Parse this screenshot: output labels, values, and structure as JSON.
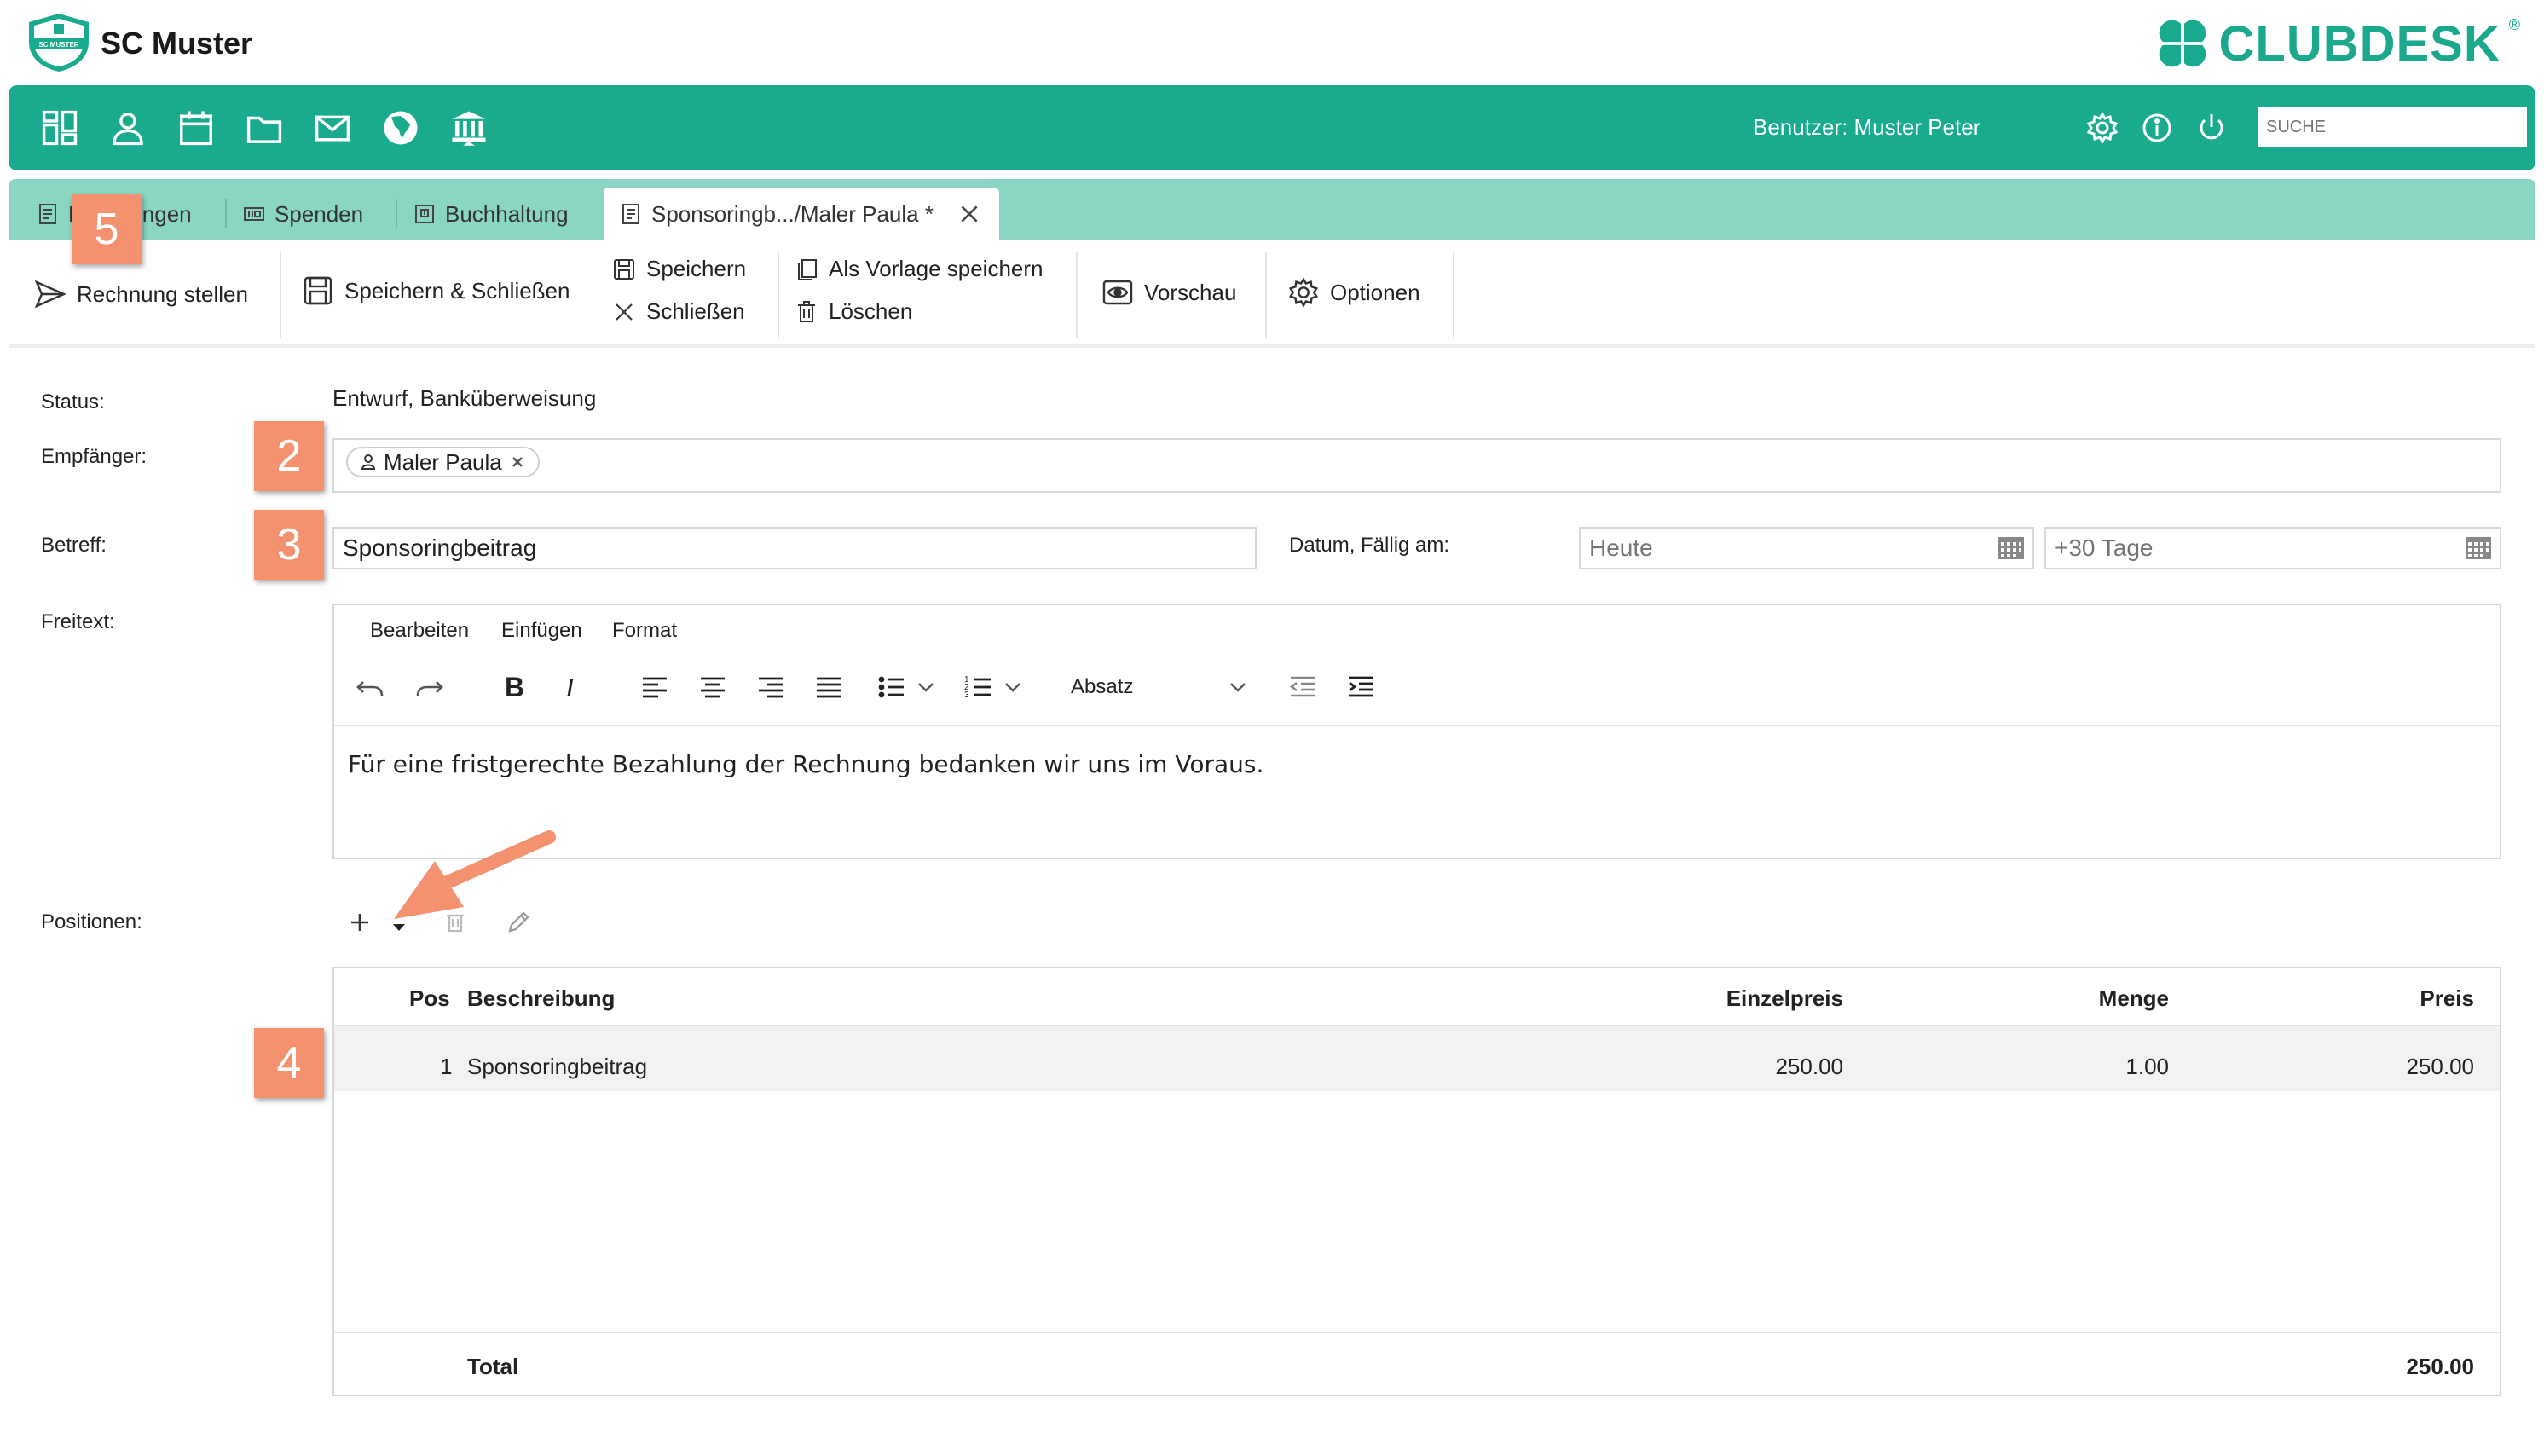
{
  "brand": {
    "club_name": "SC Muster",
    "club_badge_text": "SC MUSTER",
    "product_name": "CLUBDESK",
    "registered_mark": "®",
    "accent_color": "#1aab8e"
  },
  "nav": {
    "icons": [
      "dashboard-icon",
      "person-icon",
      "calendar-icon",
      "folder-icon",
      "mail-icon",
      "globe-icon",
      "bank-icon"
    ],
    "user_label": "Benutzer: Muster Peter",
    "search_placeholder": "SUCHE"
  },
  "tabs": [
    {
      "label": "Rechnungen",
      "visible_label_left": "R",
      "visible_label_right": "ngen",
      "icon": "invoice-icon"
    },
    {
      "label": "Spenden",
      "icon": "donation-icon"
    },
    {
      "label": "Buchhaltung",
      "icon": "ledger-icon"
    },
    {
      "label": "Sponsoringb.../Maler Paula *",
      "icon": "invoice-icon",
      "active": true
    }
  ],
  "toolbar": {
    "send_invoice": "Rechnung stellen",
    "save_close": "Speichern & Schließen",
    "save": "Speichern",
    "close": "Schließen",
    "save_template": "Als Vorlage speichern",
    "delete": "Löschen",
    "preview": "Vorschau",
    "options": "Optionen"
  },
  "form": {
    "status_label": "Status:",
    "status_value": "Entwurf, Banküberweisung",
    "recipient_label": "Empfänger:",
    "recipient_chip": "Maler Paula",
    "subject_label": "Betreff:",
    "subject_value": "Sponsoringbeitrag",
    "date_label": "Datum, Fällig am:",
    "date_placeholder": "Heute",
    "due_placeholder": "+30 Tage",
    "freetext_label": "Freitext:",
    "positions_label": "Positionen:"
  },
  "editor": {
    "menu": [
      "Bearbeiten",
      "Einfügen",
      "Format"
    ],
    "paragraph_select": "Absatz",
    "content": "Für eine fristgerechte Bezahlung der Rechnung bedanken wir uns im Voraus."
  },
  "grid": {
    "columns": [
      "Pos",
      "Beschreibung",
      "Menge",
      "Einzelpreis",
      "Preis"
    ],
    "rows": [
      {
        "pos": "1",
        "description": "Sponsoringbeitrag",
        "quantity": "1.00",
        "unit_price": "250.00",
        "price": "250.00"
      }
    ],
    "total_label": "Total",
    "total_value": "250.00"
  },
  "callouts": {
    "c5": "5",
    "c2": "2",
    "c3": "3",
    "c4": "4",
    "color": "#f4926f"
  }
}
